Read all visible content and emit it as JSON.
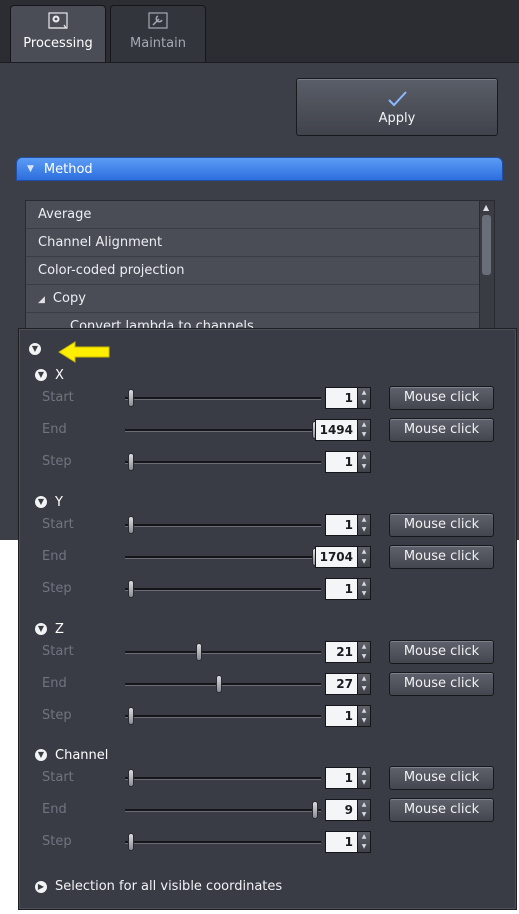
{
  "tabs": [
    {
      "label": "Processing",
      "icon": "gear-icon",
      "active": true
    },
    {
      "label": "Maintain",
      "icon": "wrench-icon",
      "active": false
    }
  ],
  "toolbar": {
    "apply_label": "Apply"
  },
  "method": {
    "header": "Method",
    "items": [
      "Average",
      "Channel Alignment",
      "Color-coded projection",
      "Copy",
      "Convert lambda to channels"
    ]
  },
  "subset": {
    "mouse_click_label": "Mouse click",
    "footer_label": "Selection for all visible coordinates",
    "sections": [
      {
        "name": "X",
        "rows": [
          {
            "label": "Start",
            "value": "1",
            "fraction": 0.0,
            "mouse": true
          },
          {
            "label": "End",
            "value": "1494",
            "fraction": 1.0,
            "mouse": true
          },
          {
            "label": "Step",
            "value": "1",
            "fraction": 0.0,
            "mouse": false
          }
        ]
      },
      {
        "name": "Y",
        "rows": [
          {
            "label": "Start",
            "value": "1",
            "fraction": 0.0,
            "mouse": true
          },
          {
            "label": "End",
            "value": "1704",
            "fraction": 1.0,
            "mouse": true
          },
          {
            "label": "Step",
            "value": "1",
            "fraction": 0.0,
            "mouse": false
          }
        ]
      },
      {
        "name": "Z",
        "rows": [
          {
            "label": "Start",
            "value": "21",
            "fraction": 0.37,
            "mouse": true
          },
          {
            "label": "End",
            "value": "27",
            "fraction": 0.48,
            "mouse": true
          },
          {
            "label": "Step",
            "value": "1",
            "fraction": 0.0,
            "mouse": false
          }
        ]
      },
      {
        "name": "Channel",
        "rows": [
          {
            "label": "Start",
            "value": "1",
            "fraction": 0.0,
            "mouse": true
          },
          {
            "label": "End",
            "value": "9",
            "fraction": 1.0,
            "mouse": true
          },
          {
            "label": "Step",
            "value": "1",
            "fraction": 0.0,
            "mouse": false
          }
        ]
      }
    ]
  },
  "colors": {
    "accent": "#3a7ee8",
    "arrow": "#ffee00"
  }
}
